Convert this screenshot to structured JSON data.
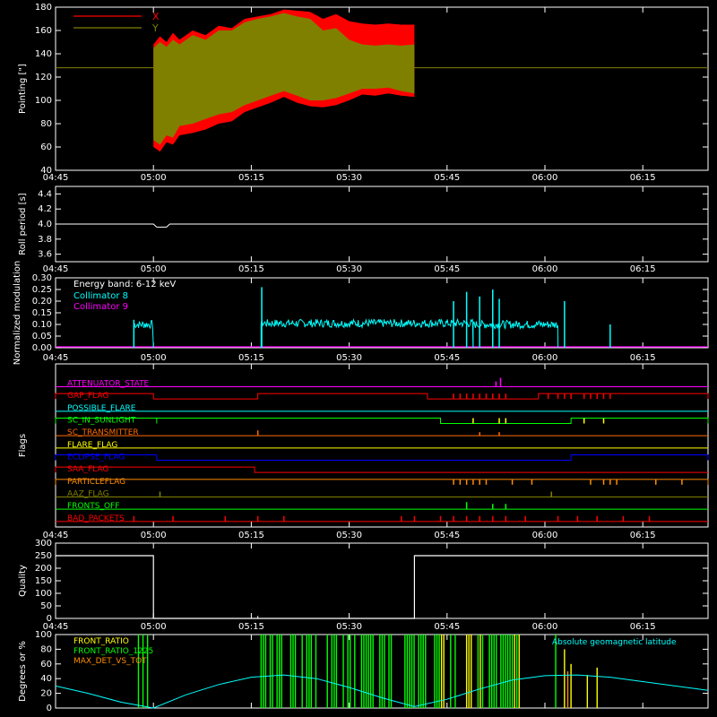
{
  "time_axis": {
    "ticks": [
      "04:45",
      "05:00",
      "05:15",
      "05:30",
      "05:45",
      "06:00",
      "06:15"
    ],
    "start_min": 285,
    "end_min": 385
  },
  "chart_data": [
    {
      "type": "area",
      "id": "pointing",
      "ylabel": "Pointing [\"]",
      "ylim": [
        40,
        180
      ],
      "yticks": [
        40,
        60,
        80,
        100,
        120,
        140,
        160,
        180
      ],
      "legend": [
        {
          "name": "X",
          "color": "#ff0000"
        },
        {
          "name": "Y",
          "color": "#808000"
        }
      ],
      "reference_line": 128,
      "x_range": [
        "05:00",
        "05:40"
      ],
      "x": [
        300,
        301,
        302,
        303,
        304,
        306,
        308,
        310,
        312,
        314,
        316,
        318,
        320,
        322,
        324,
        326,
        328,
        330,
        332,
        334,
        336,
        338,
        340
      ],
      "series": [
        {
          "name": "X",
          "color": "#ff0000",
          "upper": [
            148,
            155,
            150,
            158,
            152,
            160,
            156,
            164,
            162,
            170,
            172,
            174,
            178,
            177,
            176,
            170,
            174,
            168,
            166,
            165,
            166,
            165,
            165
          ],
          "lower": [
            60,
            56,
            64,
            62,
            70,
            72,
            75,
            80,
            82,
            90,
            94,
            98,
            103,
            98,
            95,
            94,
            96,
            100,
            105,
            104,
            106,
            104,
            103
          ]
        },
        {
          "name": "Y",
          "color": "#808000",
          "upper": [
            145,
            150,
            146,
            152,
            148,
            156,
            152,
            160,
            160,
            167,
            170,
            172,
            175,
            172,
            170,
            160,
            162,
            152,
            148,
            147,
            148,
            147,
            148
          ],
          "lower": [
            66,
            62,
            70,
            68,
            78,
            80,
            84,
            88,
            90,
            96,
            100,
            104,
            108,
            104,
            100,
            100,
            102,
            106,
            110,
            110,
            111,
            108,
            106
          ]
        }
      ]
    },
    {
      "type": "line",
      "id": "roll",
      "ylabel": "Roll period [s]",
      "ylim": [
        3.5,
        4.5
      ],
      "yticks": [
        3.6,
        3.8,
        4.0,
        4.2,
        4.4
      ],
      "x": [
        285,
        300,
        300.5,
        302,
        302.5,
        385
      ],
      "values": [
        4.0,
        4.0,
        3.96,
        3.96,
        4.0,
        4.0
      ]
    },
    {
      "type": "line",
      "id": "modulation",
      "ylabel": "Normalized modulation",
      "ylim": [
        0,
        0.3
      ],
      "yticks": [
        0.0,
        0.05,
        0.1,
        0.15,
        0.2,
        0.25,
        0.3
      ],
      "annotation": "Energy band: 6-12 keV",
      "legend": [
        {
          "name": "Collimator 8",
          "color": "#00ffff"
        },
        {
          "name": "Collimator 9",
          "color": "#ff00ff"
        }
      ],
      "segments": [
        {
          "x_start": 297,
          "x_end": 300,
          "level": 0.1
        },
        {
          "x_start": 316.5,
          "x_end": 349,
          "level": 0.105
        },
        {
          "x_start": 349,
          "x_end": 362,
          "level": 0.1
        }
      ],
      "spikes": [
        {
          "x": 297,
          "value": 0.12
        },
        {
          "x": 316.6,
          "value": 0.26
        },
        {
          "x": 346,
          "value": 0.2
        },
        {
          "x": 348,
          "value": 0.24
        },
        {
          "x": 350,
          "value": 0.22
        },
        {
          "x": 352,
          "value": 0.25
        },
        {
          "x": 353,
          "value": 0.21
        },
        {
          "x": 363,
          "value": 0.2
        },
        {
          "x": 370,
          "value": 0.1
        }
      ]
    },
    {
      "type": "table",
      "id": "flags",
      "ylabel": "Flags",
      "rows": [
        {
          "label": "ATTENUATOR_STATE",
          "color": "#ff00ff"
        },
        {
          "label": "GAP_FLAG",
          "color": "#ff0000"
        },
        {
          "label": "POSSIBLE_FLARE",
          "color": "#00ffff"
        },
        {
          "label": "SC_IN_SUNLIGHT",
          "color": "#00ff00"
        },
        {
          "label": "SC_TRANSMITTER",
          "color": "#ff6a00"
        },
        {
          "label": "FLARE_FLAG",
          "color": "#ffff00"
        },
        {
          "label": "ECLIPSE_FLAG",
          "color": "#0000ff"
        },
        {
          "label": "SAA_FLAG",
          "color": "#ff0000"
        },
        {
          "label": "PARTICLEFLAG",
          "color": "#ff8c00"
        },
        {
          "label": "AAZ_FLAG",
          "color": "#808000"
        },
        {
          "label": "FRONTS_OFF",
          "color": "#00ff00"
        },
        {
          "label": "BAD_PACKETS",
          "color": "#ff0000"
        }
      ]
    },
    {
      "type": "line",
      "id": "quality",
      "ylabel": "Quality",
      "ylim": [
        0,
        300
      ],
      "yticks": [
        0,
        50,
        100,
        150,
        200,
        250,
        300
      ],
      "x": [
        285,
        300,
        300,
        340,
        340,
        385
      ],
      "values": [
        250,
        250,
        0,
        0,
        250,
        250
      ]
    },
    {
      "type": "line",
      "id": "geomag",
      "ylabel": "Degrees or %",
      "ylim": [
        0,
        100
      ],
      "yticks": [
        0,
        20,
        40,
        60,
        80,
        100
      ],
      "legend": [
        {
          "name": "FRONT_RATIO",
          "color": "#ffff00"
        },
        {
          "name": "FRONT_RATIO_1225",
          "color": "#00ff00"
        },
        {
          "name": "MAX_DET_VS_TOT",
          "color": "#ff8c00"
        }
      ],
      "curve_label": "Absolute geomagnetic latitude",
      "curve_color": "#00ffff",
      "x": [
        285,
        290,
        295,
        300,
        305,
        310,
        315,
        320,
        325,
        330,
        335,
        340,
        345,
        350,
        355,
        360,
        365,
        370,
        375,
        380,
        385
      ],
      "values": [
        30,
        20,
        8,
        0,
        18,
        32,
        42,
        45,
        40,
        28,
        14,
        2,
        12,
        26,
        38,
        44,
        45,
        42,
        36,
        30,
        24
      ]
    }
  ]
}
